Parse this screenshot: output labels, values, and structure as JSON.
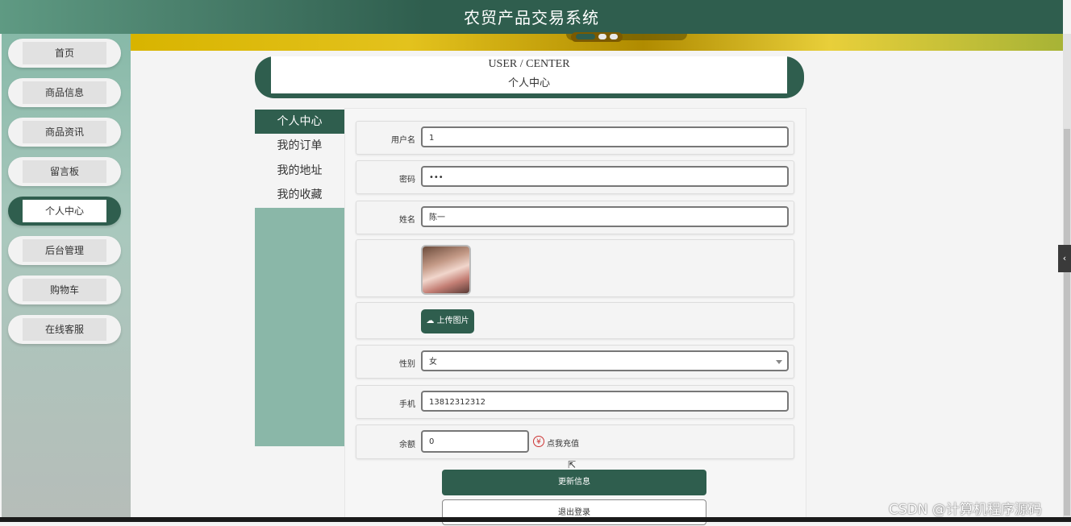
{
  "app": {
    "title": "农贸产品交易系统"
  },
  "sidebar": {
    "items": [
      {
        "label": "首页"
      },
      {
        "label": "商品信息"
      },
      {
        "label": "商品资讯"
      },
      {
        "label": "留言板"
      },
      {
        "label": "个人中心",
        "active": true
      },
      {
        "label": "后台管理"
      },
      {
        "label": "购物车"
      },
      {
        "label": "在线客服"
      }
    ]
  },
  "page_header": {
    "en": "USER / CENTER",
    "cn": "个人中心"
  },
  "menu": {
    "items": [
      {
        "label": "个人中心",
        "active": true
      },
      {
        "label": "我的订单"
      },
      {
        "label": "我的地址"
      },
      {
        "label": "我的收藏"
      }
    ]
  },
  "form": {
    "username": {
      "label": "用户名",
      "value": "1"
    },
    "password": {
      "label": "密码",
      "value": "•••"
    },
    "name": {
      "label": "姓名",
      "value": "陈一"
    },
    "upload_label": "上传图片",
    "gender": {
      "label": "性别",
      "value": "女"
    },
    "phone": {
      "label": "手机",
      "value": "13812312312"
    },
    "balance": {
      "label": "余额",
      "value": "0",
      "recharge": "点我充值",
      "icon": "yen-icon",
      "symbol": "¥"
    }
  },
  "buttons": {
    "update": "更新信息",
    "logout": "退出登录"
  },
  "side_toggle": "‹",
  "watermark": "CSDN @计算机程序源码",
  "colors": {
    "primary": "#2f5e4e",
    "menu_bg": "#8ab7a8",
    "banner": "#d8b400"
  }
}
